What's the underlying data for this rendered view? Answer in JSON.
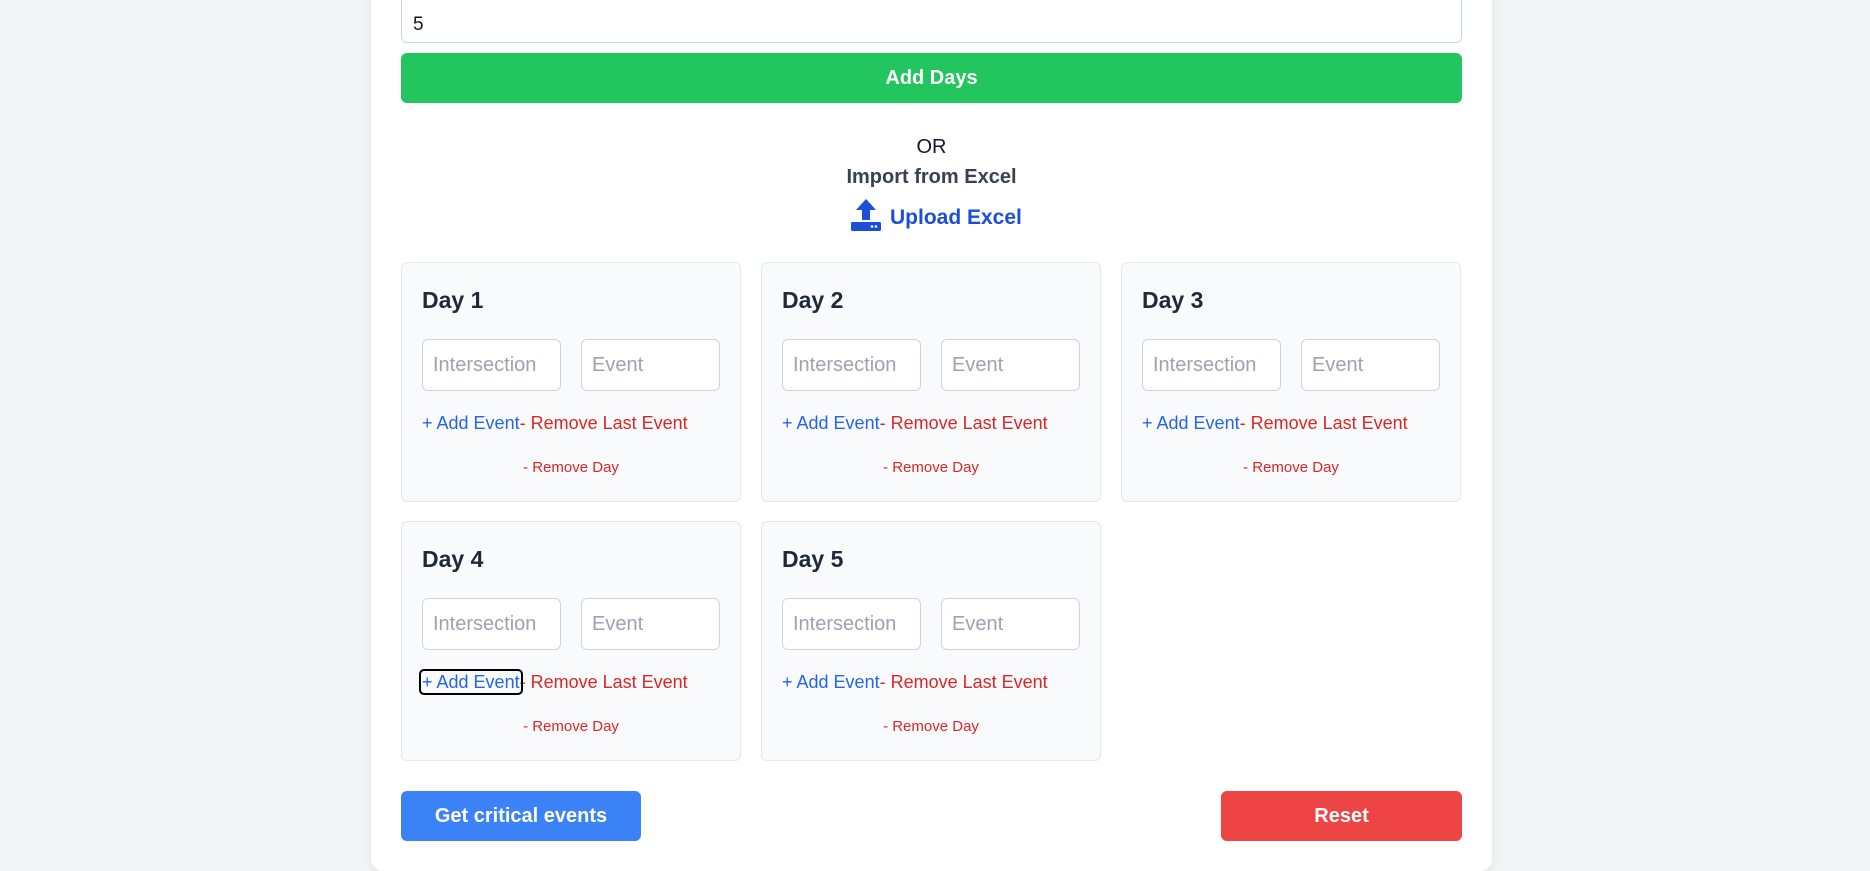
{
  "days_input": {
    "value": "5"
  },
  "add_days_label": "Add Days",
  "or_text": "OR",
  "import_text": "Import from Excel",
  "upload_label": "Upload Excel",
  "upload_icon": "upload-icon",
  "days": [
    {
      "title": "Day 1",
      "intersection_placeholder": "Intersection",
      "event_placeholder": "Event",
      "add_event": "+ Add Event",
      "remove_last_event": "- Remove Last Event",
      "remove_day": "- Remove Day"
    },
    {
      "title": "Day 2",
      "intersection_placeholder": "Intersection",
      "event_placeholder": "Event",
      "add_event": "+ Add Event",
      "remove_last_event": "- Remove Last Event",
      "remove_day": "- Remove Day"
    },
    {
      "title": "Day 3",
      "intersection_placeholder": "Intersection",
      "event_placeholder": "Event",
      "add_event": "+ Add Event",
      "remove_last_event": "- Remove Last Event",
      "remove_day": "- Remove Day"
    },
    {
      "title": "Day 4",
      "intersection_placeholder": "Intersection",
      "event_placeholder": "Event",
      "add_event": "+ Add Event",
      "remove_last_event": "- Remove Last Event",
      "remove_day": "- Remove Day"
    },
    {
      "title": "Day 5",
      "intersection_placeholder": "Intersection",
      "event_placeholder": "Event",
      "add_event": "+ Add Event",
      "remove_last_event": "- Remove Last Event",
      "remove_day": "- Remove Day"
    }
  ],
  "get_critical_label": "Get critical events",
  "reset_label": "Reset",
  "colors": {
    "green": "#22c55e",
    "blue": "#3b82f6",
    "red": "#ef4444",
    "link_blue": "#2563eb",
    "link_red": "#dc2626"
  }
}
